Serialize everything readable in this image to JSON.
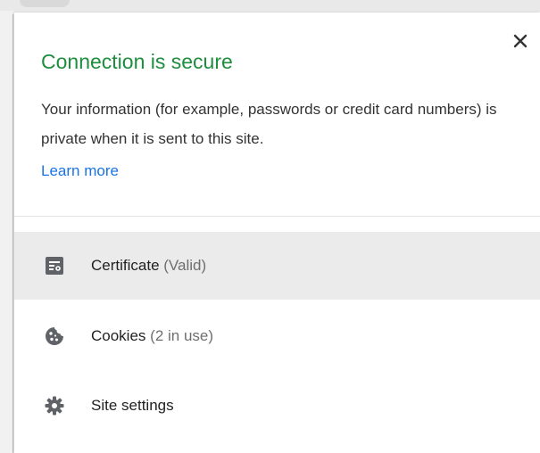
{
  "popup": {
    "title": "Connection is secure",
    "description": "Your information (for example, passwords or credit card numbers) is private when it is sent to this site.",
    "learn_more": "Learn more",
    "close_icon": "close-icon"
  },
  "rows": [
    {
      "label": "Certificate",
      "status": "(Valid)",
      "icon": "certificate-icon",
      "highlighted": true
    },
    {
      "label": "Cookies",
      "status": "(2 in use)",
      "icon": "cookie-icon",
      "highlighted": false
    },
    {
      "label": "Site settings",
      "status": "",
      "icon": "gear-icon",
      "highlighted": false
    }
  ],
  "colors": {
    "title": "#1e8e3e",
    "link": "#1a73e8",
    "hover_row": "#ebebeb",
    "icon": "#5f6368"
  }
}
